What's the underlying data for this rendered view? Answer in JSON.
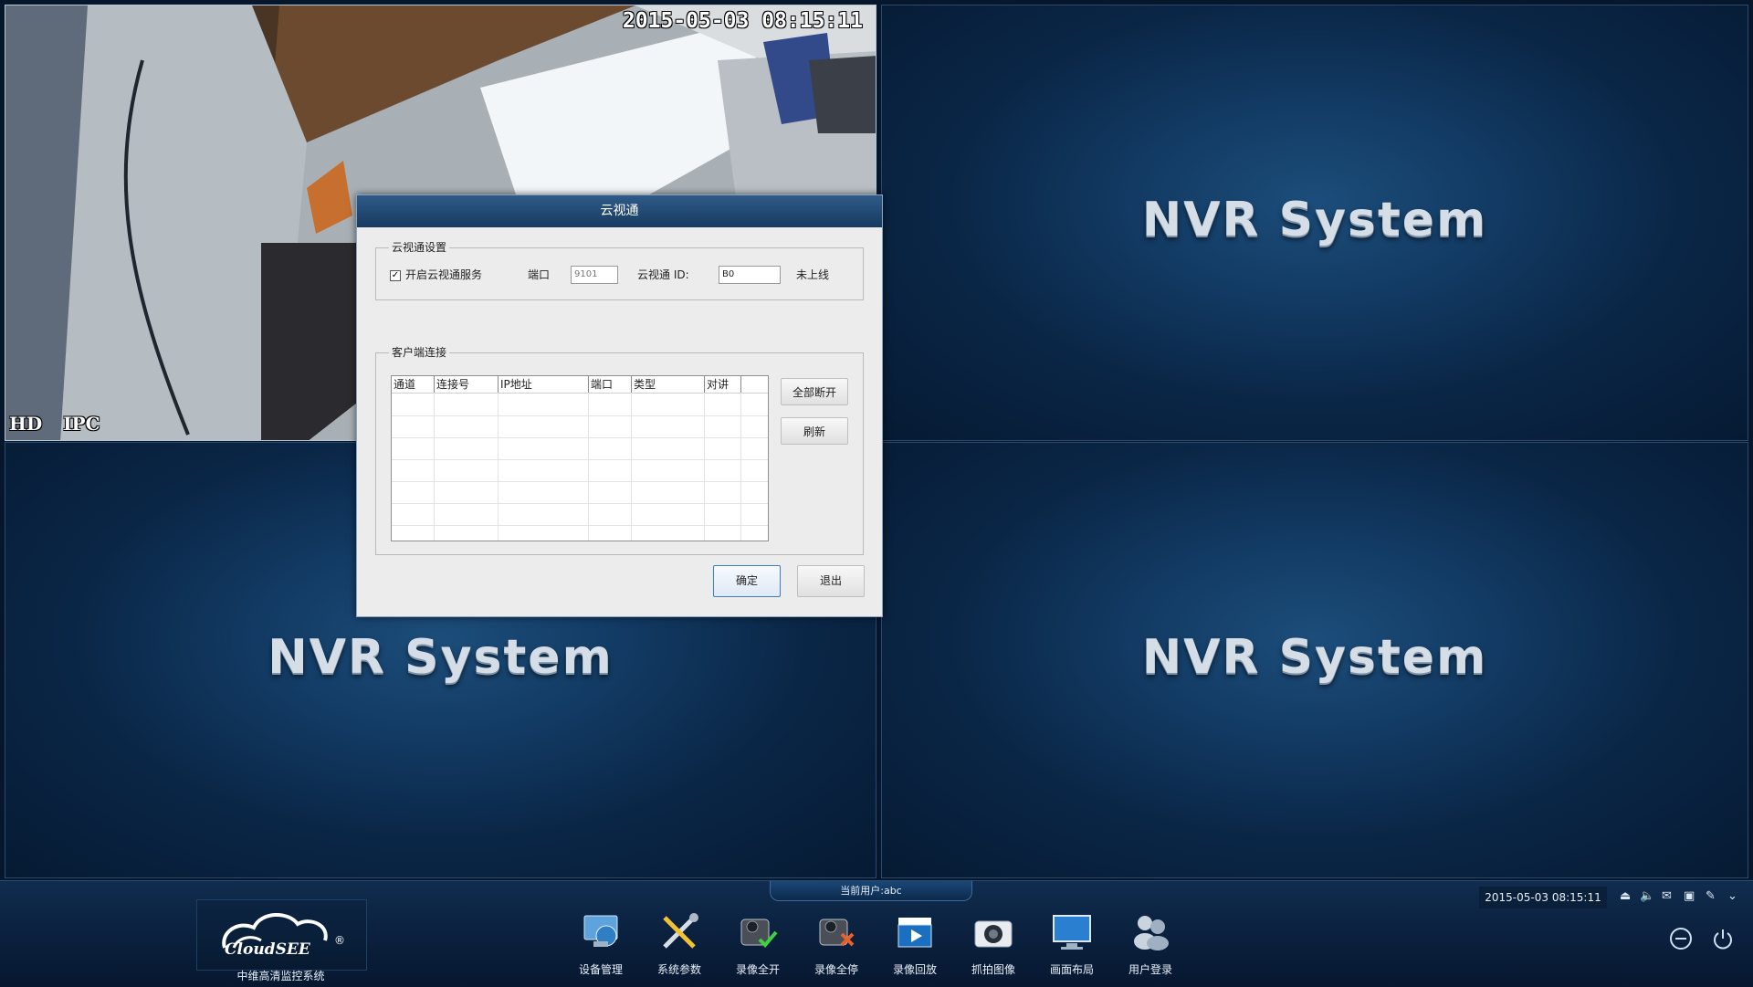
{
  "video": {
    "osd_time": "2015-05-03 08:15:11",
    "osd_tag": "HD IPC",
    "placeholder_text": "NVR System"
  },
  "dialog": {
    "title": "云视通",
    "settings_group": "云视通设置",
    "enable_label": "开启云视通服务",
    "enable_checked": true,
    "port_label": "端口",
    "port_value": "9101",
    "id_label": "云视通 ID:",
    "id_value": "B0",
    "status": "未上线",
    "clients_group": "客户端连接",
    "columns": [
      "通道",
      "连接号",
      "IP地址",
      "端口",
      "类型",
      "对讲"
    ],
    "disconnect_all": "全部断开",
    "refresh": "刷新",
    "ok": "确定",
    "exit": "退出"
  },
  "taskbar": {
    "current_user": "当前用户:abc",
    "clock": "2015-05-03 08:15:11",
    "brand_logo": "CloudSEE",
    "brand_label": "中维高清监控系统",
    "tools": [
      {
        "label": "设备管理",
        "icon": "device-manage-icon"
      },
      {
        "label": "系统参数",
        "icon": "system-params-icon"
      },
      {
        "label": "录像全开",
        "icon": "record-all-on-icon"
      },
      {
        "label": "录像全停",
        "icon": "record-all-stop-icon"
      },
      {
        "label": "录像回放",
        "icon": "playback-icon"
      },
      {
        "label": "抓拍图像",
        "icon": "snapshot-icon"
      },
      {
        "label": "画面布局",
        "icon": "layout-icon"
      },
      {
        "label": "用户登录",
        "icon": "user-login-icon"
      }
    ],
    "tray_icons": [
      "eject-icon",
      "volume-icon",
      "mail-icon",
      "network-icon",
      "pin-icon",
      "chevron-down-icon"
    ],
    "right_buttons": [
      "minimize-icon",
      "power-icon"
    ]
  },
  "colors": {
    "accent": "#1a4776",
    "pane_bg": "#123a63",
    "dialog_bg": "#ececec"
  }
}
